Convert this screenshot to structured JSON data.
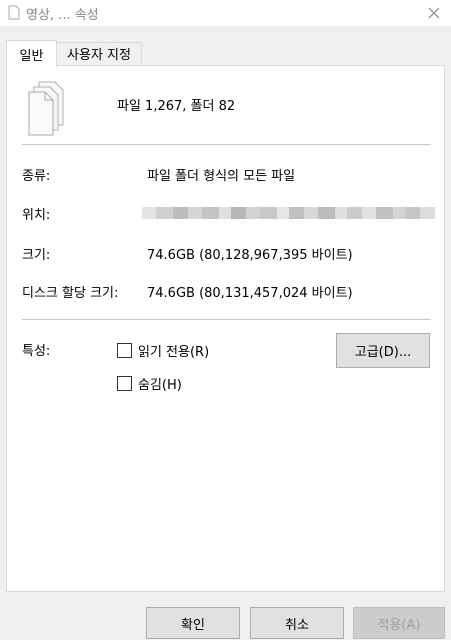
{
  "window": {
    "title": "영상, ... 속성",
    "close_icon": "close-icon"
  },
  "tabs": [
    {
      "label": "일반",
      "active": true
    },
    {
      "label": "사용자 지정",
      "active": false
    }
  ],
  "general": {
    "count_text": "파일 1,267, 폴더 82",
    "type_label": "종류:",
    "type_value": "파일 폴더 형식의 모든 파일",
    "location_label": "위치:",
    "size_label": "크기:",
    "size_value": "74.6GB (80,128,967,395 바이트)",
    "disk_size_label": "디스크 할당 크기:",
    "disk_size_value": "74.6GB (80,131,457,024 바이트)",
    "attributes_label": "특성:",
    "readonly_label": "읽기 전용(R)",
    "hidden_label": "숨김(H)",
    "advanced_button": "고급(D)..."
  },
  "footer": {
    "ok": "확인",
    "cancel": "취소",
    "apply": "적용(A)"
  }
}
